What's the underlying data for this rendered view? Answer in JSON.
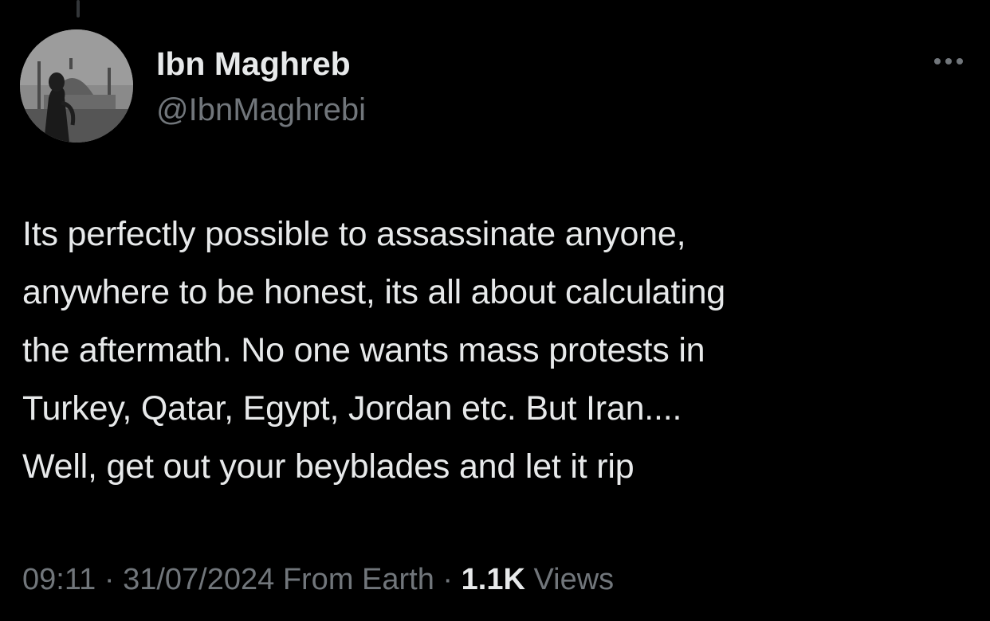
{
  "author": {
    "display_name": "Ibn Maghreb",
    "handle": "@IbnMaghrebi",
    "avatar_icon": "avatar-mosque-photo"
  },
  "menu": {
    "more_icon": "more-options-icon"
  },
  "tweet": {
    "lines": [
      "Its perfectly possible to assassinate anyone,",
      "anywhere to be honest, its all about calculating",
      "the aftermath. No one wants mass protests in",
      "Turkey, Qatar, Egypt, Jordan etc. But Iran....",
      "Well, get out your beyblades and let it rip"
    ]
  },
  "meta": {
    "time": "09:11",
    "separator": "·",
    "date": "31/07/2024",
    "source": "From Earth",
    "views_count": "1.1K",
    "views_label": "Views"
  },
  "colors": {
    "background": "#000000",
    "primary_text": "#e7e9ea",
    "secondary_text": "#71767b"
  }
}
